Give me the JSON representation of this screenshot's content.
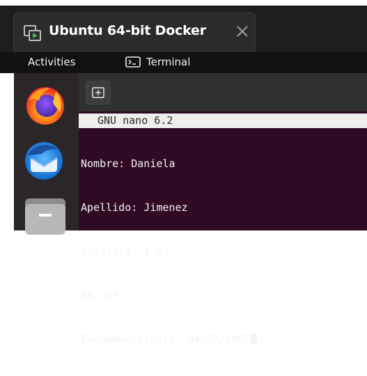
{
  "vm_window": {
    "tab_title": "Ubuntu 64-bit Docker",
    "icons": {
      "vm": "vm-play-icon",
      "close": "close-icon"
    }
  },
  "top_panel": {
    "activities_label": "Activities",
    "app_menu_label": "Terminal",
    "app_menu_icon": "terminal-icon"
  },
  "dock": {
    "apps": [
      {
        "icon": "firefox-icon"
      },
      {
        "icon": "thunderbird-icon"
      },
      {
        "icon": "files-icon"
      }
    ]
  },
  "terminal": {
    "new_tab_icon": "new-tab-icon",
    "nano_title": "GNU nano 6.2",
    "lines": [
      "Nombre: Daniela",
      "Apellido: Jimenez",
      "Estatura: 1.52",
      "RH: O+",
      "FechaNacimiento: 04/23/2005"
    ],
    "colors": {
      "background": "#300a24",
      "text": "#f4f4f4"
    }
  }
}
